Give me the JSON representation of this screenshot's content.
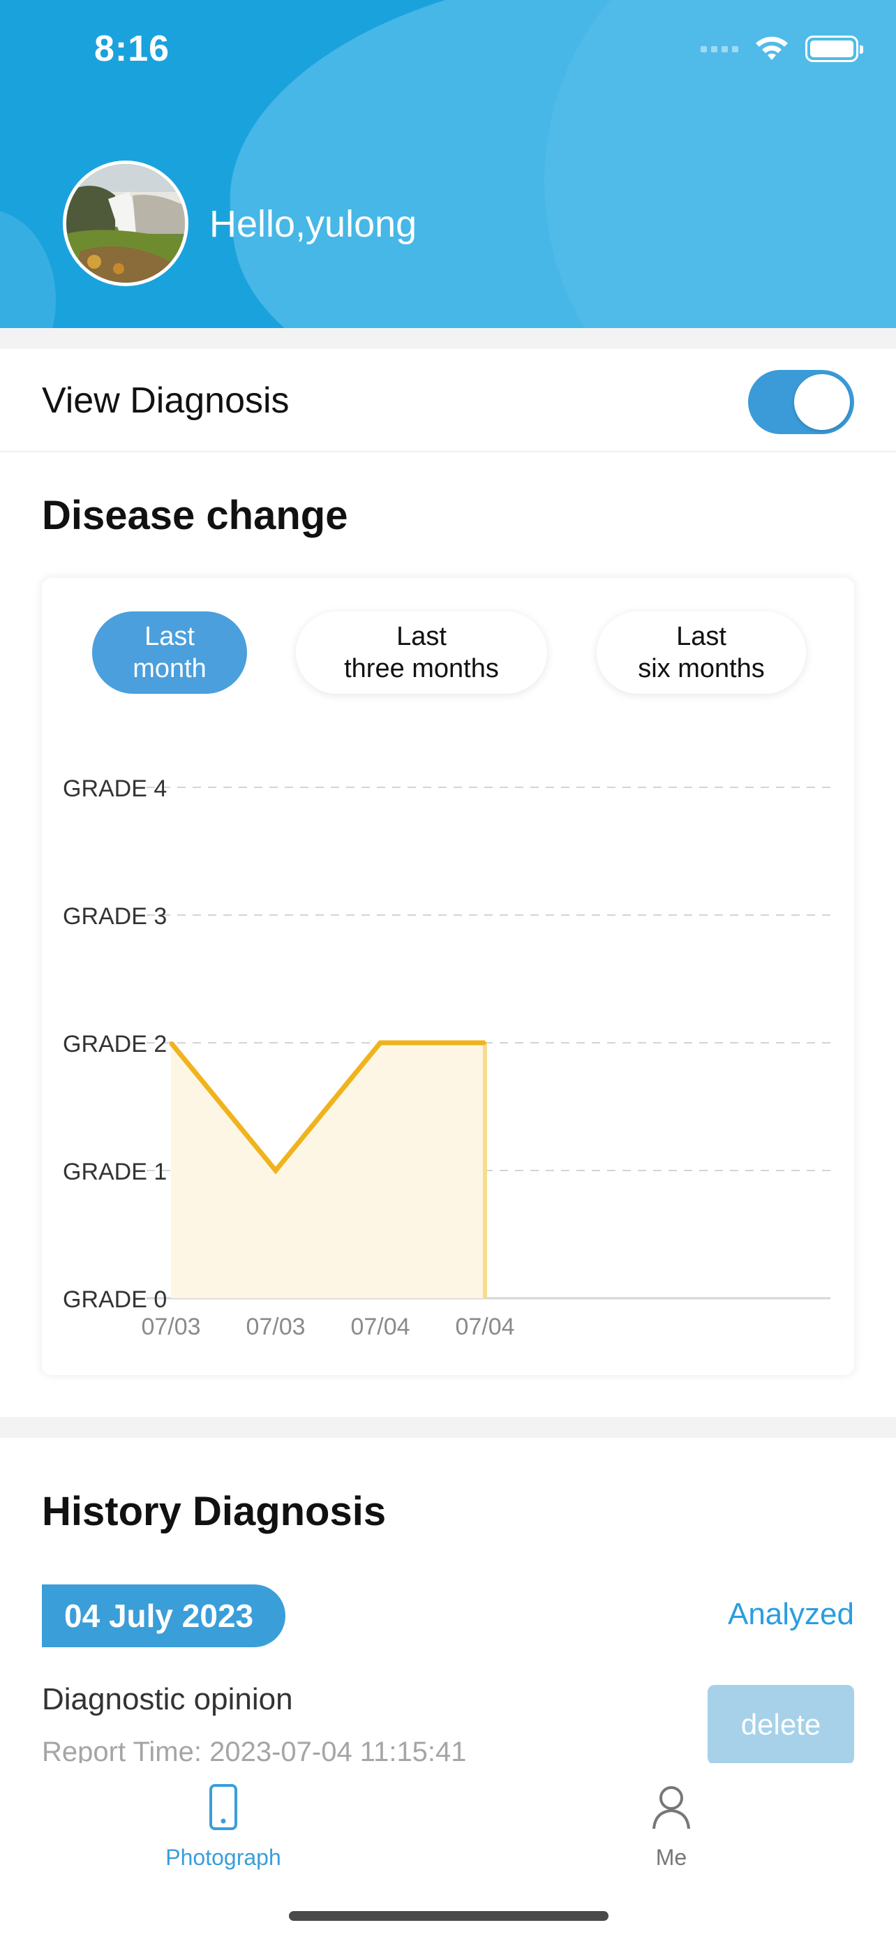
{
  "status_bar": {
    "time": "8:16"
  },
  "header": {
    "greeting": "Hello,yulong"
  },
  "view_diagnosis": {
    "label": "View Diagnosis",
    "enabled": true
  },
  "disease_change": {
    "title": "Disease change",
    "filters": [
      {
        "label": "Last\nmonth",
        "active": true
      },
      {
        "label": "Last\nthree months",
        "active": false
      },
      {
        "label": "Last\nsix months",
        "active": false
      }
    ]
  },
  "chart_data": {
    "type": "area",
    "categories": [
      "07/03",
      "07/03",
      "07/04",
      "07/04"
    ],
    "values": [
      2,
      1,
      2,
      2
    ],
    "y_tick_labels": [
      "GRADE 0",
      "GRADE 1",
      "GRADE 2",
      "GRADE 3",
      "GRADE 4"
    ],
    "ylim": [
      0,
      4
    ],
    "grid": true,
    "colors": {
      "line": "#f0b31e",
      "fill": "#fdf6e4"
    }
  },
  "history": {
    "title": "History Diagnosis",
    "entries": [
      {
        "date": "04 July 2023",
        "status": "Analyzed",
        "opinion": "Diagnostic opinion",
        "report_time": "Report Time: 2023-07-04 11:15:41",
        "delete_label": "delete"
      }
    ]
  },
  "tabbar": {
    "tabs": [
      {
        "label": "Photograph",
        "icon": "phone-icon",
        "active": true,
        "color": "#3a9ed9"
      },
      {
        "label": "Me",
        "icon": "person-icon",
        "active": false,
        "color": "#777777"
      }
    ]
  }
}
